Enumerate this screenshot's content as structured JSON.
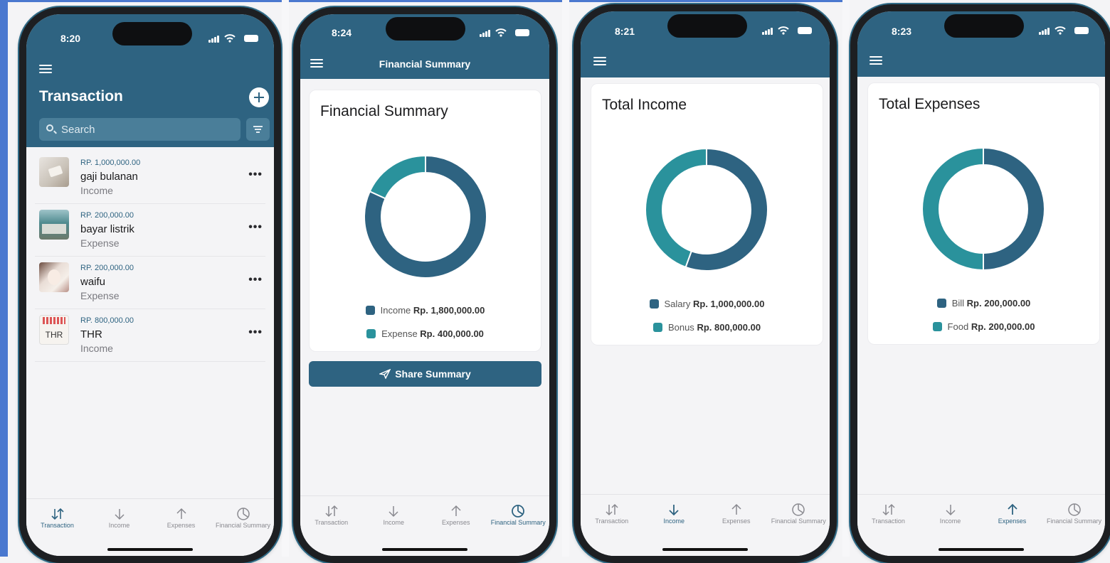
{
  "colors": {
    "primary": "#2e6381",
    "secondary": "#2a929c",
    "accent_bg": "#4a78cf"
  },
  "tab_labels": [
    "Transaction",
    "Income",
    "Expenses",
    "Financial Summary"
  ],
  "phone1": {
    "time": "8:20",
    "title": "Transaction",
    "search_placeholder": "Search",
    "transactions": [
      {
        "amount": "RP. 1,000,000.00",
        "name": "gaji bulanan",
        "type": "Income"
      },
      {
        "amount": "RP. 200,000.00",
        "name": "bayar listrik",
        "type": "Expense"
      },
      {
        "amount": "RP. 200,000.00",
        "name": "waifu",
        "type": "Expense"
      },
      {
        "amount": "RP. 800,000.00",
        "name": "THR",
        "type": "Income",
        "thumb_text": "THR"
      }
    ]
  },
  "phone2": {
    "time": "8:24",
    "nav_title": "Financial Summary",
    "card_title": "Financial Summary",
    "legend": [
      {
        "label": "Income",
        "value": "Rp. 1,800,000.00"
      },
      {
        "label": "Expense",
        "value": "Rp. 400,000.00"
      }
    ],
    "share_label": "Share Summary"
  },
  "phone3": {
    "time": "8:21",
    "card_title": "Total Income",
    "legend": [
      {
        "label": "Salary",
        "value": "Rp. 1,000,000.00"
      },
      {
        "label": "Bonus",
        "value": "Rp. 800,000.00"
      }
    ]
  },
  "phone4": {
    "time": "8:23",
    "card_title": "Total Expenses",
    "legend": [
      {
        "label": "Bill",
        "value": "Rp. 200,000.00"
      },
      {
        "label": "Food",
        "value": "Rp. 200,000.00"
      }
    ]
  },
  "donuts": {
    "summary": [
      1800000,
      400000
    ],
    "income": [
      1000000,
      800000
    ],
    "expenses": [
      200000,
      200000
    ]
  }
}
